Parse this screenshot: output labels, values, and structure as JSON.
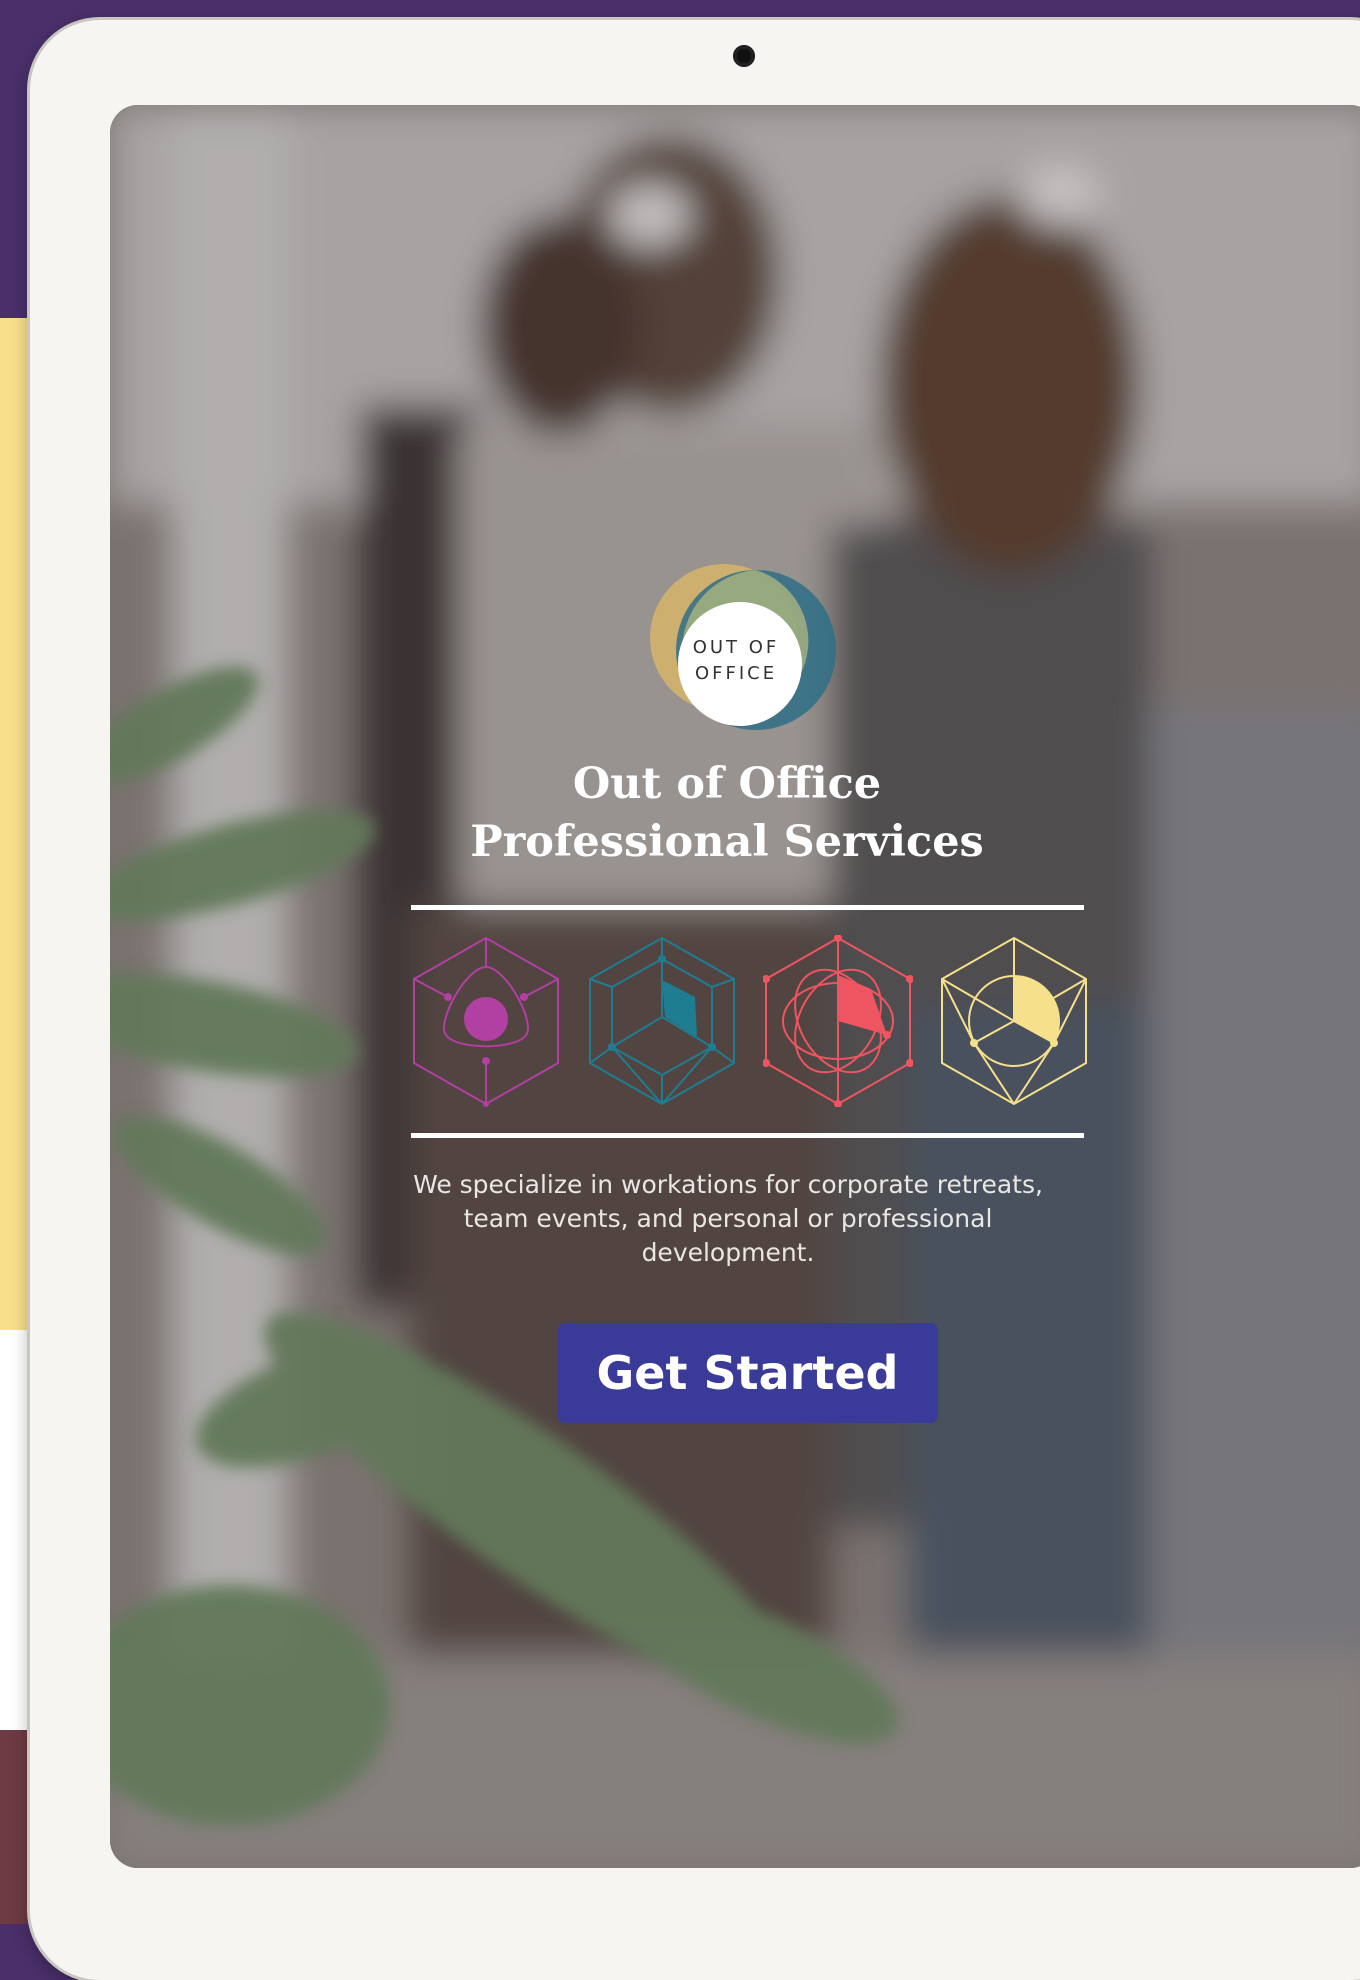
{
  "logo": {
    "line1": "OUT OF",
    "line2": "OFFICE"
  },
  "hero": {
    "title_line1": "Out of Office",
    "title_line2": "Professional Services",
    "description": "We specialize in workations for corporate retreats, team events, and personal or professional development.",
    "cta_label": "Get Started"
  },
  "icons": [
    {
      "name": "magenta-hexagon-circle-icon",
      "color": "#b23fa2"
    },
    {
      "name": "teal-hexagon-cube-icon",
      "color": "#1f7d92"
    },
    {
      "name": "coral-hexagon-star-icon",
      "color": "#ef5560"
    },
    {
      "name": "yellow-hexagon-pie-icon",
      "color": "#f7e08c"
    }
  ],
  "colors": {
    "page_background": "#4a2f6a",
    "accent_yellow": "#f7e08c",
    "button": "#3a3a98"
  }
}
